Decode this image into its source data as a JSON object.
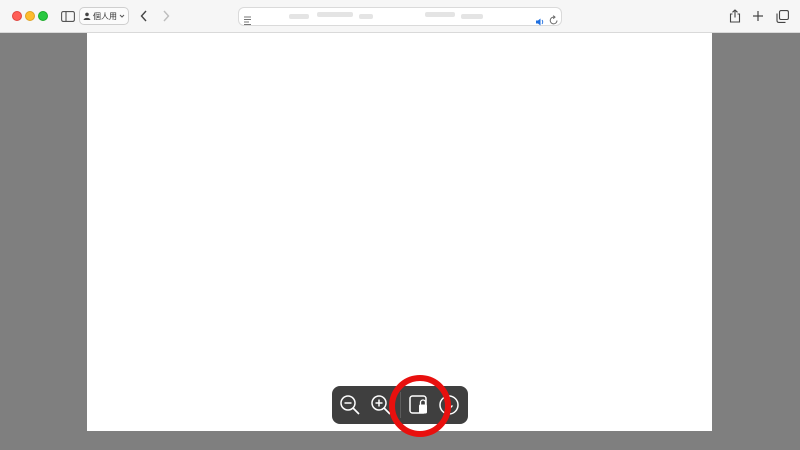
{
  "toolbar": {
    "profile_label": "個人用",
    "icons": {
      "sidebar": "sidebar-icon",
      "back": "chevron-left-icon",
      "forward": "chevron-right-icon",
      "share": "share-icon",
      "new_tab": "plus-icon",
      "tabs_overview": "tabs-overview-icon",
      "reader": "reader-icon",
      "audio": "speaker-icon",
      "reload": "reload-icon"
    }
  },
  "pdf_controls": {
    "icons": [
      "zoom-out-icon",
      "zoom-in-icon",
      "save-pdf-icon",
      "download-icon"
    ]
  },
  "colors": {
    "highlight": "#e8100e",
    "toolbar_bg": "#f6f6f6",
    "background": "#7f7f7f",
    "controls_bg": "#3f3f3f"
  }
}
